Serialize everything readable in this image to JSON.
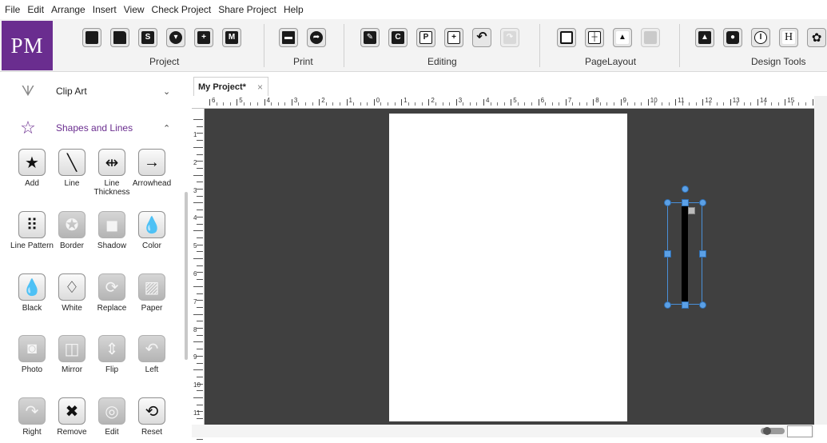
{
  "menu": [
    "File",
    "Edit",
    "Arrange",
    "Insert",
    "View",
    "Check Project",
    "Share Project",
    "Help"
  ],
  "logo": "PM",
  "ribbon": {
    "groups": [
      {
        "label": "Project",
        "buttons": [
          "new-icon",
          "open-folder-icon",
          "save-icon",
          "save-dropdown-icon",
          "add-page-icon",
          "templates-icon"
        ]
      },
      {
        "label": "Print",
        "buttons": [
          "printer-icon",
          "share-icon"
        ]
      },
      {
        "label": "Editing",
        "buttons": [
          "text-icon",
          "copy-icon",
          "paste-icon",
          "add-icon",
          "undo-icon",
          "redo-icon"
        ]
      },
      {
        "label": "PageLayout",
        "buttons": [
          "layer-icon",
          "guides-icon",
          "align-icon",
          "grid-icon"
        ]
      },
      {
        "label": "Design Tools",
        "buttons": [
          "image-icon",
          "camera-icon",
          "symbol-icon",
          "heading-icon",
          "flower-icon"
        ]
      }
    ],
    "glyphs": {
      "save": "S",
      "paste": "P",
      "copy": "C",
      "templates": "M",
      "heading": "H"
    }
  },
  "sidebar": {
    "sections": [
      {
        "label": "Clip Art",
        "expanded": false
      },
      {
        "label": "Shapes and Lines",
        "expanded": true
      }
    ],
    "tools": [
      {
        "label": "Add",
        "icon": "star-icon",
        "glyph": "★",
        "enabled": true
      },
      {
        "label": "Line",
        "icon": "line-icon",
        "glyph": "╲",
        "enabled": true
      },
      {
        "label": "Line Thickness",
        "icon": "line-thickness-icon",
        "glyph": "⇹",
        "enabled": true
      },
      {
        "label": "Arrowhead",
        "icon": "arrowhead-icon",
        "glyph": "→",
        "enabled": true
      },
      {
        "label": "Line Pattern",
        "icon": "line-pattern-icon",
        "glyph": "⠿",
        "enabled": true
      },
      {
        "label": "Border",
        "icon": "border-icon",
        "glyph": "✪",
        "enabled": false
      },
      {
        "label": "Shadow",
        "icon": "shadow-icon",
        "glyph": "◼",
        "enabled": false
      },
      {
        "label": "Color",
        "icon": "color-drops-icon",
        "glyph": "💧",
        "enabled": true
      },
      {
        "label": "Black",
        "icon": "black-drops-icon",
        "glyph": "💧",
        "enabled": true
      },
      {
        "label": "White",
        "icon": "white-drops-icon",
        "glyph": "♢",
        "enabled": true
      },
      {
        "label": "Replace",
        "icon": "replace-icon",
        "glyph": "⟳",
        "enabled": false
      },
      {
        "label": "Paper",
        "icon": "paper-icon",
        "glyph": "▨",
        "enabled": false
      },
      {
        "label": "Photo",
        "icon": "photo-icon",
        "glyph": "◙",
        "enabled": false
      },
      {
        "label": "Mirror",
        "icon": "mirror-icon",
        "glyph": "◫",
        "enabled": false
      },
      {
        "label": "Flip",
        "icon": "flip-icon",
        "glyph": "⇕",
        "enabled": false
      },
      {
        "label": "Left",
        "icon": "rotate-left-icon",
        "glyph": "↶",
        "enabled": false
      },
      {
        "label": "Right",
        "icon": "rotate-right-icon",
        "glyph": "↷",
        "enabled": false
      },
      {
        "label": "Remove",
        "icon": "remove-icon",
        "glyph": "✖",
        "enabled": true
      },
      {
        "label": "Edit",
        "icon": "edit-icon",
        "glyph": "◎",
        "enabled": false
      },
      {
        "label": "Reset",
        "icon": "reset-icon",
        "glyph": "⟲",
        "enabled": true
      }
    ]
  },
  "document": {
    "tab_title": "My Project*",
    "tab_close": "×",
    "hruler_labels": [
      "6",
      "5",
      "4",
      "3",
      "2",
      "1",
      "0",
      "1",
      "2",
      "3",
      "4",
      "5",
      "6",
      "7",
      "8",
      "9",
      "10",
      "11",
      "12",
      "13",
      "14",
      "15"
    ],
    "vruler_labels": [
      "1",
      "2",
      "3",
      "4",
      "5",
      "6",
      "7",
      "8",
      "9",
      "10",
      "11"
    ]
  }
}
